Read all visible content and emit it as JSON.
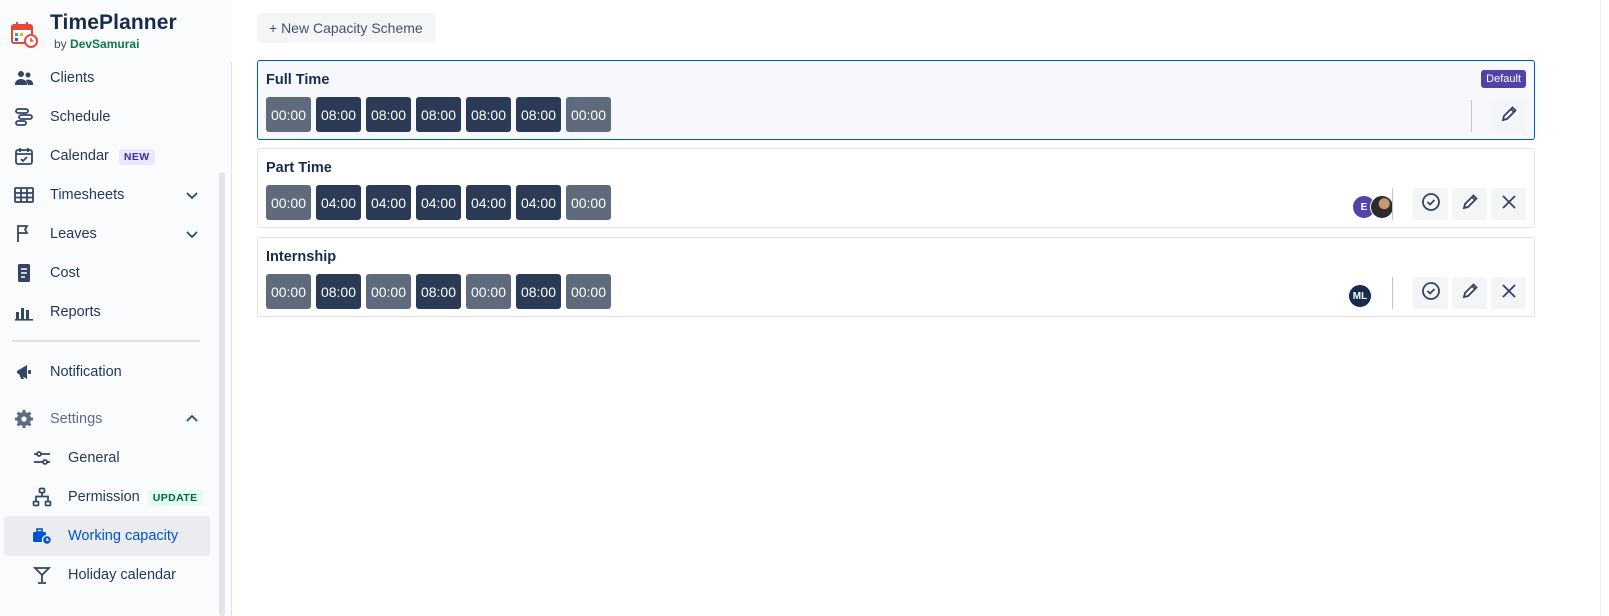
{
  "app": {
    "title": "TimePlanner",
    "by_prefix": "by",
    "by_name": "DevSamurai"
  },
  "sidebar": {
    "items": [
      {
        "label": "Clients",
        "icon": "people-icon"
      },
      {
        "label": "Schedule",
        "icon": "timeline-icon"
      },
      {
        "label": "Calendar",
        "icon": "calendar-check-icon",
        "badge": "NEW"
      },
      {
        "label": "Timesheets",
        "icon": "table-grid-icon"
      },
      {
        "label": "Leaves",
        "icon": "flag-icon"
      },
      {
        "label": "Cost",
        "icon": "receipt-icon"
      },
      {
        "label": "Reports",
        "icon": "bar-chart-icon"
      },
      {
        "label": "Notification",
        "icon": "megaphone-icon"
      },
      {
        "label": "Settings",
        "icon": "gear-icon"
      }
    ],
    "settings_sub": [
      {
        "label": "General",
        "icon": "sliders-icon"
      },
      {
        "label": "Permission",
        "icon": "hierarchy-icon",
        "badge": "UPDATE"
      },
      {
        "label": "Working capacity",
        "icon": "briefcase-clock-icon"
      },
      {
        "label": "Holiday calendar",
        "icon": "cocktail-icon"
      }
    ]
  },
  "main": {
    "new_button": "+ New Capacity Scheme",
    "schemes": [
      {
        "name": "Full Time",
        "default_badge": "Default",
        "hours": [
          "00:00",
          "08:00",
          "08:00",
          "08:00",
          "08:00",
          "08:00",
          "00:00"
        ]
      },
      {
        "name": "Part Time",
        "hours": [
          "00:00",
          "04:00",
          "04:00",
          "04:00",
          "04:00",
          "04:00",
          "00:00"
        ],
        "avatars": [
          "E",
          ""
        ]
      },
      {
        "name": "Internship",
        "hours": [
          "00:00",
          "08:00",
          "00:00",
          "08:00",
          "00:00",
          "08:00",
          "00:00"
        ],
        "avatars": [
          "ML"
        ]
      }
    ]
  },
  "colors": {
    "accent": "#0052cc",
    "day_on": "#2b3a55",
    "day_off": "#5f6b7c",
    "default_badge": "#5243aa"
  }
}
